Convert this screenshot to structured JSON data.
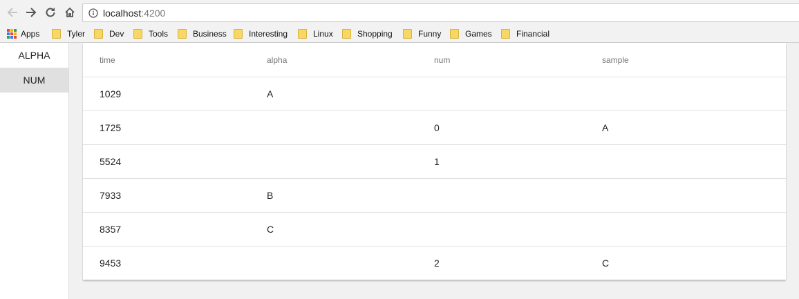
{
  "browser": {
    "url_host": "localhost",
    "url_port": ":4200",
    "nav_icons": [
      "back-arrow-icon",
      "forward-arrow-icon",
      "reload-icon",
      "home-icon",
      "info-icon"
    ],
    "bookmarks": [
      {
        "label": "Apps",
        "icon": "apps-grid-icon"
      },
      {
        "label": "Tyler",
        "icon": "folder-icon"
      },
      {
        "label": "Dev",
        "icon": "folder-icon"
      },
      {
        "label": "Tools",
        "icon": "folder-icon"
      },
      {
        "label": "Business",
        "icon": "folder-icon"
      },
      {
        "label": "Interesting",
        "icon": "folder-icon"
      },
      {
        "label": "Linux",
        "icon": "folder-icon"
      },
      {
        "label": "Shopping",
        "icon": "folder-icon"
      },
      {
        "label": "Funny",
        "icon": "folder-icon"
      },
      {
        "label": "Games",
        "icon": "folder-icon"
      },
      {
        "label": "Financial",
        "icon": "folder-icon"
      }
    ]
  },
  "sidenav": {
    "items": [
      {
        "label": "ALPHA",
        "active": false
      },
      {
        "label": "NUM",
        "active": true
      }
    ]
  },
  "table": {
    "columns": [
      "time",
      "alpha",
      "num",
      "sample"
    ],
    "rows": [
      [
        "1029",
        "A",
        "",
        ""
      ],
      [
        "1725",
        "",
        "0",
        "A"
      ],
      [
        "5524",
        "",
        "1",
        ""
      ],
      [
        "7933",
        "B",
        "",
        ""
      ],
      [
        "8357",
        "C",
        "",
        ""
      ],
      [
        "9453",
        "",
        "2",
        "C"
      ]
    ]
  },
  "colors": {
    "page_bg": "#f1f1f1",
    "active_nav_bg": "#e0e0e0",
    "header_text": "#757575",
    "divider": "#e0e0e0"
  }
}
